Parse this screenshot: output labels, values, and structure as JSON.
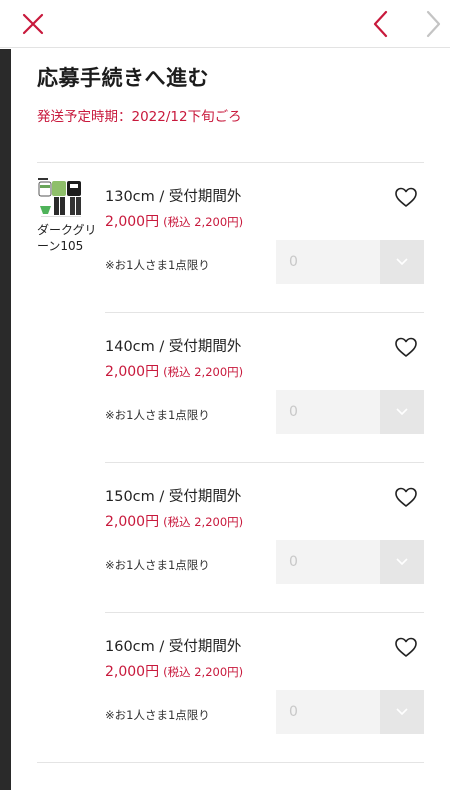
{
  "nav": {
    "close_icon": "close-x-icon",
    "prev_icon": "chevron-left-icon",
    "next_icon": "chevron-right-icon",
    "accent_color": "#c8193c",
    "disabled_color": "#c4c4c4"
  },
  "page": {
    "title": "応募手続きへ進む",
    "shipping": "発送予定時期：2022/12下旬ごろ"
  },
  "product": {
    "color_name": "ダークグリーン105",
    "image_icon": "product-outfit-thumbnail"
  },
  "variants": [
    {
      "size": "130cm / 受付期間外",
      "price": "2,000円",
      "tax": "(税込 2,200円)",
      "limit": "※お1人さま1点限り",
      "qty": "0"
    },
    {
      "size": "140cm / 受付期間外",
      "price": "2,000円",
      "tax": "(税込 2,200円)",
      "limit": "※お1人さま1点限り",
      "qty": "0"
    },
    {
      "size": "150cm / 受付期間外",
      "price": "2,000円",
      "tax": "(税込 2,200円)",
      "limit": "※お1人さま1点限り",
      "qty": "0"
    },
    {
      "size": "160cm / 受付期間外",
      "price": "2,000円",
      "tax": "(税込 2,200円)",
      "limit": "※お1人さま1点限り",
      "qty": "0"
    }
  ]
}
